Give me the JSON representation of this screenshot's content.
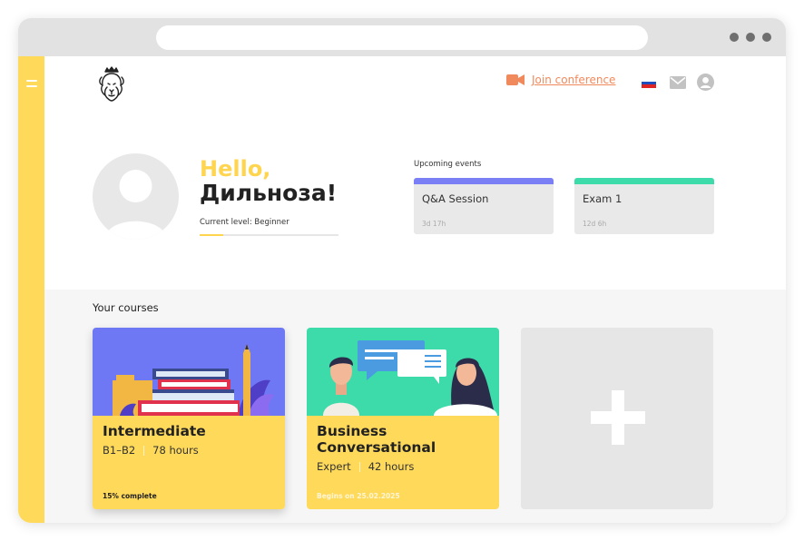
{
  "header": {
    "join_label": "Join conference",
    "flag_colors": [
      "#ffffff",
      "#1f4fbf",
      "#e02424"
    ],
    "icons": [
      "menu-icon",
      "camera-icon",
      "flag-ru-icon",
      "mail-icon",
      "user-icon",
      "plus-icon"
    ]
  },
  "profile": {
    "greeting": "Hello,",
    "name": "Дильноза!",
    "level_label": "Current level: Beginner",
    "level_progress": 0.17
  },
  "events": {
    "label": "Upcoming events",
    "items": [
      {
        "title": "Q&A Session",
        "time": "3d 17h",
        "color": "#7b7ff5"
      },
      {
        "title": "Exam 1",
        "time": "12d 6h",
        "color": "#3ddba9"
      }
    ]
  },
  "courses": {
    "title": "Your courses",
    "items": [
      {
        "name": "Intermediate",
        "level": "B1–B2",
        "hours": "78 hours",
        "footer": "15% complete",
        "image_color": "#6e78f5"
      },
      {
        "name": "Business Conversational",
        "level": "Expert",
        "hours": "42 hours",
        "footer": "Begins on 25.02.2025",
        "image_color": "#3ddba9"
      }
    ]
  },
  "colors": {
    "accent_yellow": "#ffd95a",
    "greeting_yellow": "#ffd54f",
    "link_orange": "#f08a5d",
    "event_purple": "#7b7ff5",
    "event_green": "#3ddba9"
  }
}
